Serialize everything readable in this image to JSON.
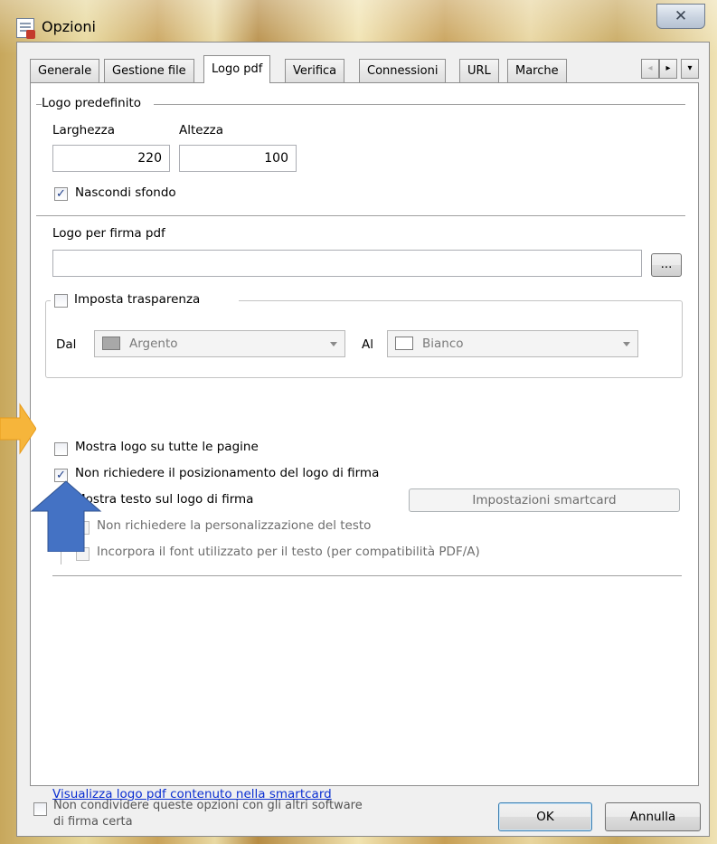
{
  "window": {
    "title": "Opzioni",
    "close_glyph": "✕"
  },
  "tabs": [
    {
      "label": "Generale",
      "active": false
    },
    {
      "label": "Gestione file",
      "active": false
    },
    {
      "label": "Logo pdf",
      "active": true
    },
    {
      "label": "Verifica",
      "active": false
    },
    {
      "label": "Connessioni",
      "active": false
    },
    {
      "label": "URL",
      "active": false
    },
    {
      "label": "Marche",
      "active": false
    }
  ],
  "tab_scroll": {
    "left": "◂",
    "right": "▸",
    "menu": "▾"
  },
  "logo_predefinito": {
    "group_label": "Logo predefinito",
    "width_label": "Larghezza",
    "width_value": "220",
    "height_label": "Altezza",
    "height_value": "100",
    "hide_background_label": "Nascondi sfondo",
    "hide_background_checked": true
  },
  "logo_firma": {
    "label": "Logo per firma pdf",
    "value": "",
    "browse_label": "..."
  },
  "trasparenza": {
    "label": "Imposta trasparenza",
    "checked": false,
    "from_label": "Dal",
    "from_value": "Argento",
    "from_color": "#a8a8a8",
    "to_label": "Al",
    "to_value": "Bianco",
    "to_color": "#ffffff"
  },
  "options": {
    "show_all_pages": {
      "label": "Mostra logo su tutte le pagine",
      "checked": false
    },
    "no_positioning": {
      "label": "Non richiedere il posizionamento del logo di firma",
      "checked": true
    },
    "show_text": {
      "label": "Mostra testo sul logo di firma",
      "checked": false
    },
    "smartcard_button": "Impostazioni smartcard",
    "no_custom_text": {
      "label": "Non richiedere la personalizzazione del testo",
      "checked": false
    },
    "embed_font": {
      "label": "Incorpora il font utilizzato per il testo (per compatibilità PDF/A)",
      "checked": false
    }
  },
  "view_logo_link": "Visualizza logo pdf contenuto nella smartcard",
  "footer": {
    "share_label_line1": "Non condividere queste opzioni con gli altri software",
    "share_label_line2": "di firma certa",
    "share_checked": false,
    "ok_label": "OK",
    "cancel_label": "Annulla"
  },
  "colors": {
    "annotation_arrow_orange": "#f6b53b",
    "annotation_arrow_blue": "#4472c4",
    "link": "#0b2fd2"
  }
}
